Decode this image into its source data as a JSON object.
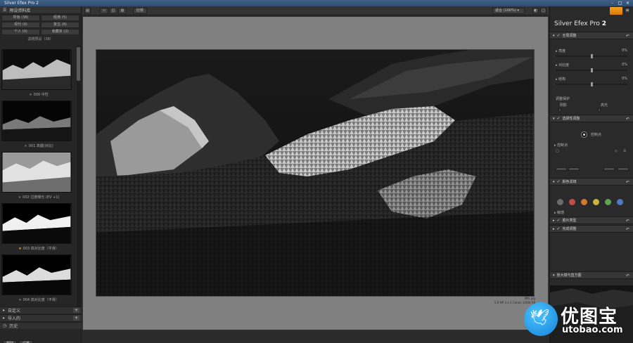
{
  "window": {
    "title": "Silver Efex Pro 2",
    "minimize": "-",
    "maximize": "□",
    "close": "×"
  },
  "left_panel": {
    "header": "预设资料库",
    "categories": [
      {
        "label": "所有 (38)"
      },
      {
        "label": "经典 (5)"
      },
      {
        "label": "现代 (9)"
      },
      {
        "label": "复古 (8)"
      },
      {
        "label": "个人 (0)"
      },
      {
        "label": "收藏夹 (2)"
      }
    ],
    "presets_heading": "滤镜预设（38）",
    "presets": [
      {
        "label": "000 中性",
        "favorite": false
      },
      {
        "label": "001 高键(对比)",
        "favorite": false
      },
      {
        "label": "002 过度曝光 (EV +1)",
        "favorite": false
      },
      {
        "label": "003 高对比度（平滑）",
        "favorite": true
      },
      {
        "label": "004 高对比度（平滑）",
        "favorite": false
      }
    ],
    "sections": [
      {
        "label": "自定义",
        "plus": "+"
      },
      {
        "label": "导入的",
        "plus": "+"
      },
      {
        "label": "历史"
      }
    ],
    "bottom_buttons": {
      "help": "帮助",
      "settings": "设置"
    }
  },
  "toolbar": {
    "compare_label": "比较",
    "zoom_label": "适合 (100%)"
  },
  "canvas": {
    "file_name": "IMG.jpg",
    "file_info": "5.8 MP  3 x 2  Canon  1/200  f/8"
  },
  "right_panel": {
    "app_title": "Silver Efex Pro",
    "app_version": "2",
    "global_adjust": "全局调整",
    "sliders": [
      {
        "name": "亮度",
        "value": "0%",
        "position": 0.5
      },
      {
        "name": "对比度",
        "value": "0%",
        "position": 0.5
      },
      {
        "name": "结构",
        "value": "0%",
        "position": 0.5
      }
    ],
    "tone_protect": "调整保护",
    "shadows": "阴影",
    "highlights": "高光",
    "selective_adjust": "选择性调整",
    "control_point": "控制点",
    "control_points_list": "控制点",
    "color_filter": "颜色滤镜",
    "filter_colors": [
      "#6b6b6b",
      "#c24b4b",
      "#d07a30",
      "#c8b63a",
      "#5aa54e",
      "#4a7bc7"
    ],
    "sensitivity": "敏感",
    "film_types": "胶片类型",
    "finishing": "完成调整",
    "loupe": "放大镜与直方图",
    "reset_symbol": "↶",
    "check_symbol": "✓"
  },
  "watermark": {
    "name_cn": "优图宝",
    "url": "utobao.com"
  }
}
